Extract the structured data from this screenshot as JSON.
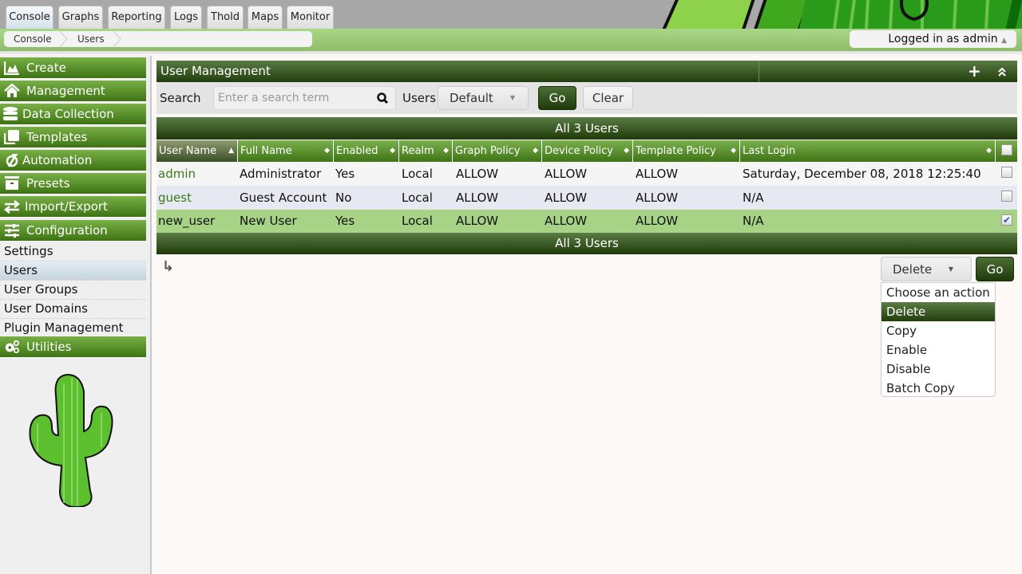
{
  "tabs": [
    {
      "label": "Console",
      "active": true
    },
    {
      "label": "Graphs"
    },
    {
      "label": "Reporting"
    },
    {
      "label": "Logs"
    },
    {
      "label": "Thold"
    },
    {
      "label": "Maps"
    },
    {
      "label": "Monitor"
    }
  ],
  "breadcrumb": [
    "Console",
    "Users"
  ],
  "login": {
    "label": "Logged in as admin",
    "caret": "▲"
  },
  "sidebar": {
    "menus": [
      {
        "label": "Create",
        "icon": "chart-area-icon"
      },
      {
        "label": "Management",
        "icon": "home-icon"
      },
      {
        "label": "Data Collection",
        "icon": "database-icon"
      },
      {
        "label": "Templates",
        "icon": "copy-icon"
      },
      {
        "label": "Automation",
        "icon": "automation-icon"
      },
      {
        "label": "Presets",
        "icon": "archive-icon"
      },
      {
        "label": "Import/Export",
        "icon": "exchange-icon"
      },
      {
        "label": "Configuration",
        "icon": "sliders-icon"
      }
    ],
    "subitems": [
      "Settings",
      "Users",
      "User Groups",
      "User Domains",
      "Plugin Management"
    ],
    "active_sub": "Users",
    "utilities": {
      "label": "Utilities",
      "icon": "cogs-icon"
    }
  },
  "panel": {
    "title": "User Management",
    "add_icon": "+",
    "collapse_icon": "⌃"
  },
  "filter": {
    "search_label": "Search",
    "search_placeholder": "Enter a search term",
    "users_label": "Users",
    "users_value": "Default",
    "go_label": "Go",
    "clear_label": "Clear"
  },
  "table": {
    "caption": "All 3 Users",
    "columns": [
      "User Name",
      "Full Name",
      "Enabled",
      "Realm",
      "Graph Policy",
      "Device Policy",
      "Template Policy",
      "Last Login"
    ],
    "sorted_column": "User Name",
    "rows": [
      {
        "user": "admin",
        "full": "Administrator",
        "enabled": "Yes",
        "realm": "Local",
        "graph": "ALLOW",
        "device": "ALLOW",
        "template": "ALLOW",
        "last": "Saturday, December 08, 2018 12:25:40",
        "checked": false
      },
      {
        "user": "guest",
        "full": "Guest Account",
        "enabled": "No",
        "realm": "Local",
        "graph": "ALLOW",
        "device": "ALLOW",
        "template": "ALLOW",
        "last": "N/A",
        "checked": false
      },
      {
        "user": "new_user",
        "full": "New User",
        "enabled": "Yes",
        "realm": "Local",
        "graph": "ALLOW",
        "device": "ALLOW",
        "template": "ALLOW",
        "last": "N/A",
        "checked": true
      }
    ],
    "footer_caption": "All 3 Users"
  },
  "actions": {
    "selected": "Delete",
    "go_label": "Go",
    "arrow_icon": "↳",
    "options": [
      "Choose an action",
      "Delete",
      "Copy",
      "Enable",
      "Disable",
      "Batch Copy"
    ]
  },
  "colors": {
    "header_dark": "#223d0c",
    "menu_green": "#3d7313",
    "selected_row": "#a6d386",
    "link": "#3b7a1c"
  }
}
